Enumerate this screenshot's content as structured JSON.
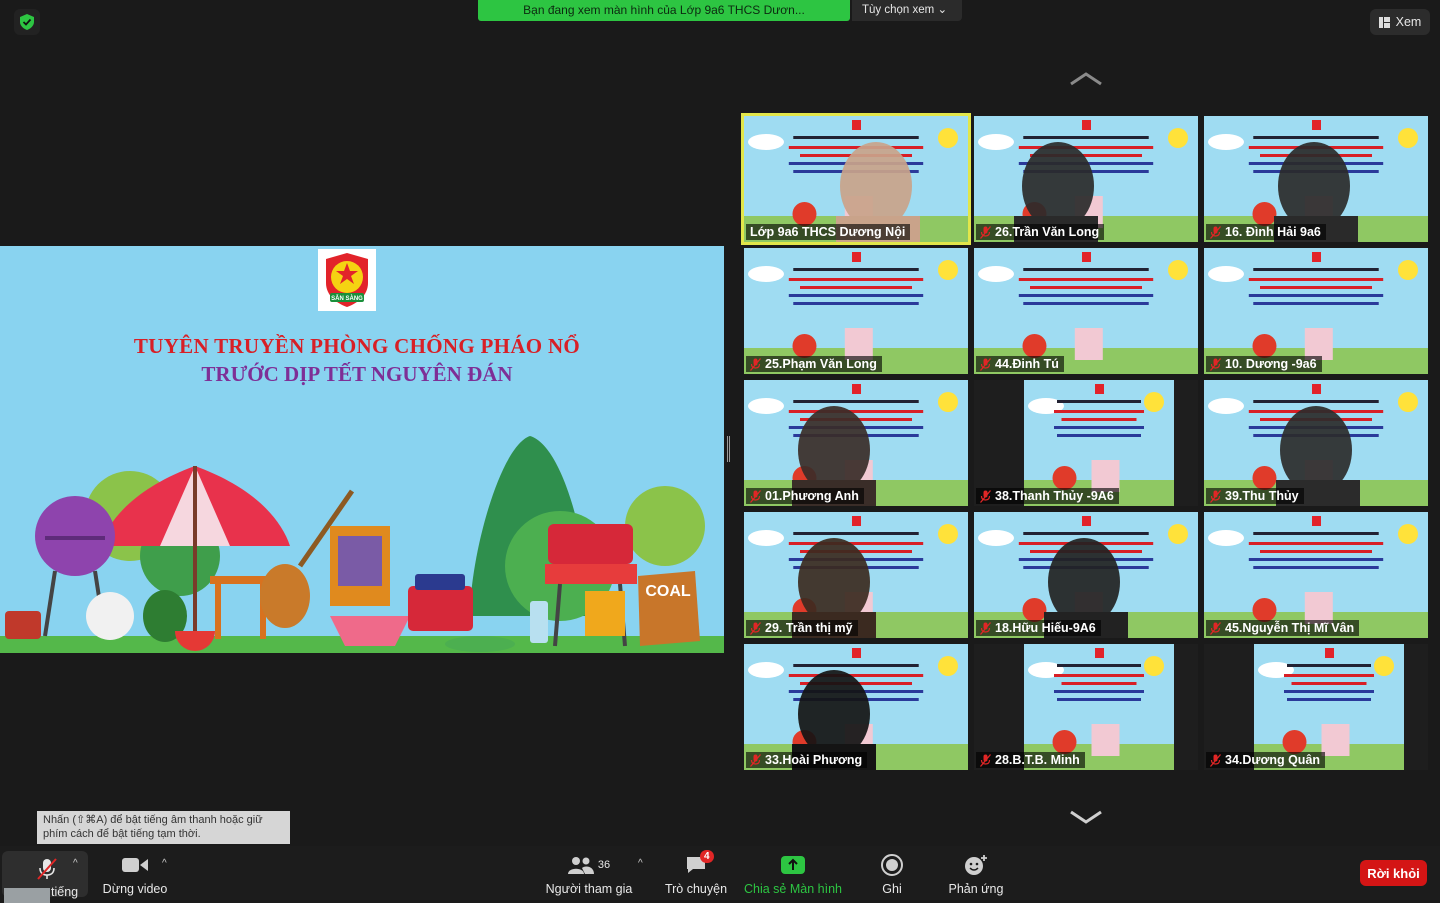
{
  "banner": {
    "text": "Bạn đang xem màn hình của Lớp 9a6 THCS Dươn...",
    "options_label": "Tùy chọn xem"
  },
  "view_button": {
    "label": "Xem"
  },
  "slide": {
    "logo_text": "SẴN SÀNG",
    "title_line1": "TUYÊN TRUYỀN PHÒNG CHỐNG PHÁO NỔ",
    "title_line2": "TRƯỚC DỊP TẾT NGUYÊN ĐÁN",
    "coal_label": "COAL"
  },
  "participants": [
    {
      "name": "Lớp 9a6 THCS Dương Nội",
      "muted": false,
      "active": true
    },
    {
      "name": "26.Trần Văn Long",
      "muted": true
    },
    {
      "name": "16. Đình Hải 9a6",
      "muted": true
    },
    {
      "name": "25.Phạm Văn Long",
      "muted": true
    },
    {
      "name": "44.Đinh Tú",
      "muted": true
    },
    {
      "name": "10. Dương -9a6",
      "muted": true
    },
    {
      "name": "01.Phương Anh",
      "muted": true
    },
    {
      "name": "38.Thanh Thủy -9A6",
      "muted": true
    },
    {
      "name": "39.Thu Thủy",
      "muted": true
    },
    {
      "name": "29. Trần thị mỹ",
      "muted": true
    },
    {
      "name": "18.Hữu Hiếu-9A6",
      "muted": true
    },
    {
      "name": "45.Nguyễn Thị Mĩ Vân",
      "muted": true
    },
    {
      "name": "33.Hoài Phương",
      "muted": true
    },
    {
      "name": "28.B.T.B. Minh",
      "muted": true
    },
    {
      "name": "34.Dương Quân",
      "muted": true
    }
  ],
  "hint": {
    "text": "Nhấn  (⇧⌘A) để bật tiếng âm thanh hoặc giữ phím cách để bật tiếng tạm thời."
  },
  "toolbar": {
    "unmute_label": "tiếng",
    "video_label": "Dừng video",
    "participants_label": "Người tham gia",
    "participants_count": "36",
    "chat_label": "Trò chuyện",
    "chat_badge": "4",
    "share_label": "Chia sẻ Màn hình",
    "record_label": "Ghi",
    "reactions_label": "Phản ứng",
    "leave_label": "Rời khỏi"
  },
  "colors": {
    "share_green": "#2dc542",
    "leave_red": "#d41515",
    "active_border": "#e2e64a"
  }
}
